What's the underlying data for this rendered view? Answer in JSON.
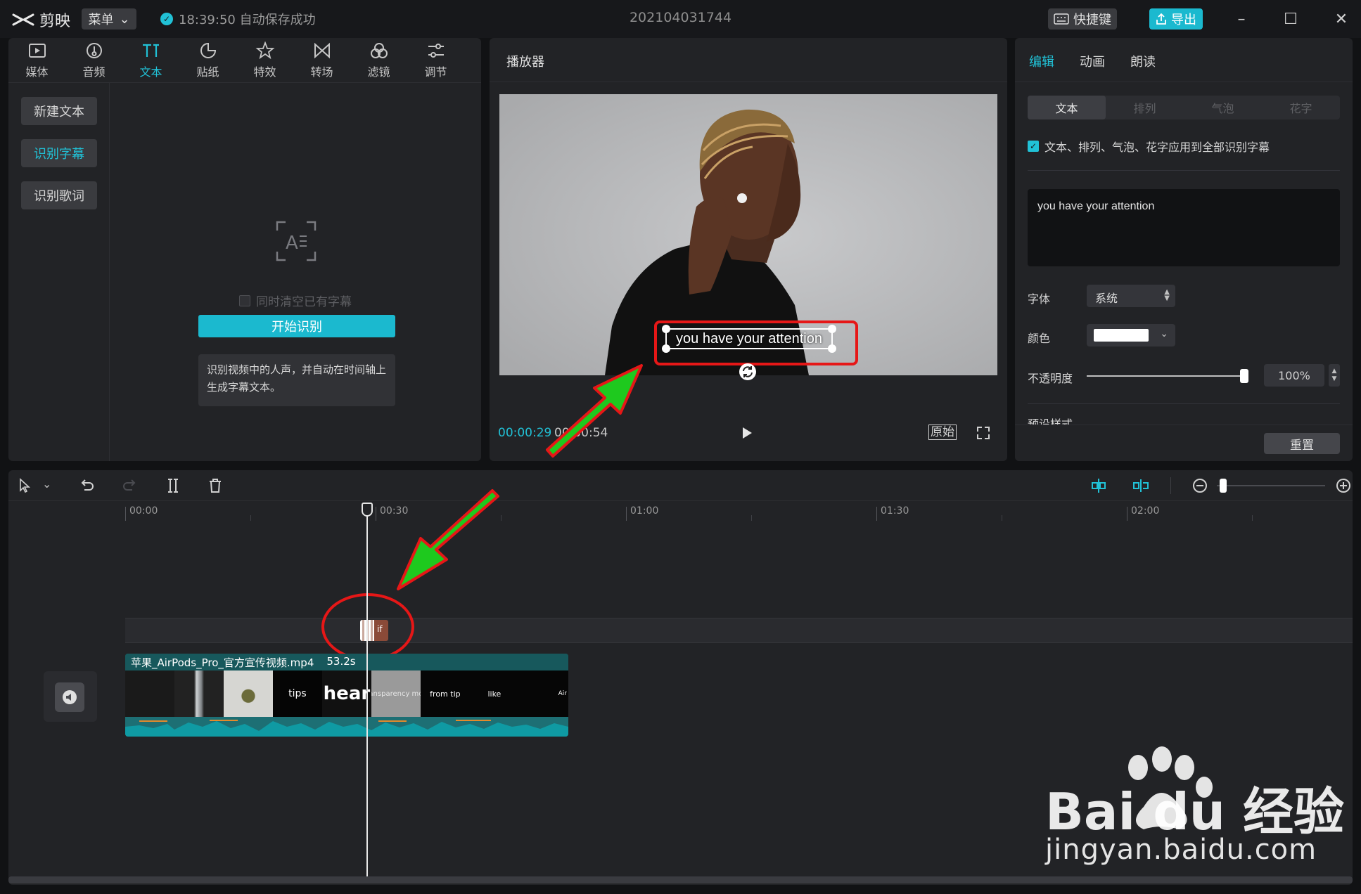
{
  "app": {
    "logo_text": "剪映",
    "menu_label": "菜单",
    "save_status": "18:39:50 自动保存成功",
    "project_title": "202104031744",
    "hotkey_label": "快捷键",
    "export_label": "导出"
  },
  "toolbar": {
    "items": [
      {
        "label": "媒体",
        "icon": "media-icon"
      },
      {
        "label": "音频",
        "icon": "audio-icon"
      },
      {
        "label": "文本",
        "icon": "text-icon",
        "active": true
      },
      {
        "label": "贴纸",
        "icon": "sticker-icon"
      },
      {
        "label": "特效",
        "icon": "effects-icon"
      },
      {
        "label": "转场",
        "icon": "transition-icon"
      },
      {
        "label": "滤镜",
        "icon": "filter-icon"
      },
      {
        "label": "调节",
        "icon": "adjust-icon"
      }
    ]
  },
  "text_nav": {
    "new_text": "新建文本",
    "recognize_subtitles": "识别字幕",
    "recognize_lyrics": "识别歌词"
  },
  "recognition": {
    "clear_existing_label": "同时清空已有字幕",
    "start_button": "开始识别",
    "description": "识别视频中的人声，并自动在时间轴上生成字幕文本。"
  },
  "player": {
    "title": "播放器",
    "subtitle_text": "you have your attention",
    "current_time": "00:00:29",
    "total_time": "00:00:54",
    "original_label": "原始"
  },
  "edit_panel": {
    "tabs": [
      "编辑",
      "动画",
      "朗读"
    ],
    "segments": [
      "文本",
      "排列",
      "气泡",
      "花字"
    ],
    "apply_all_label": "文本、排列、气泡、花字应用到全部识别字幕",
    "text_value": "you have your attention",
    "font_label": "字体",
    "font_value": "系统",
    "color_label": "颜色",
    "color_value": "#ffffff",
    "opacity_label": "不透明度",
    "opacity_value": "100%",
    "opacity_fraction": 1.0,
    "preset_label": "预设样式",
    "reset_label": "重置"
  },
  "timeline": {
    "ruler": [
      "00:00",
      "00:30",
      "01:00",
      "01:30",
      "02:00"
    ],
    "subtitle_clip_label": "if",
    "video_clip": {
      "name": "苹果_AirPods_Pro_官方宣传视频.mp4",
      "duration": "53.2s",
      "thumbs": [
        "",
        "",
        "",
        "tips",
        "hear",
        "ansparency mo",
        "from tip",
        "like",
        "Air"
      ]
    }
  },
  "watermark": {
    "brand": "Bai du 经验",
    "url": "jingyan.baidu.com"
  },
  "colors": {
    "accent": "#21c1d6",
    "annotation_red": "#e61717",
    "annotation_green": "#1ec91e"
  }
}
